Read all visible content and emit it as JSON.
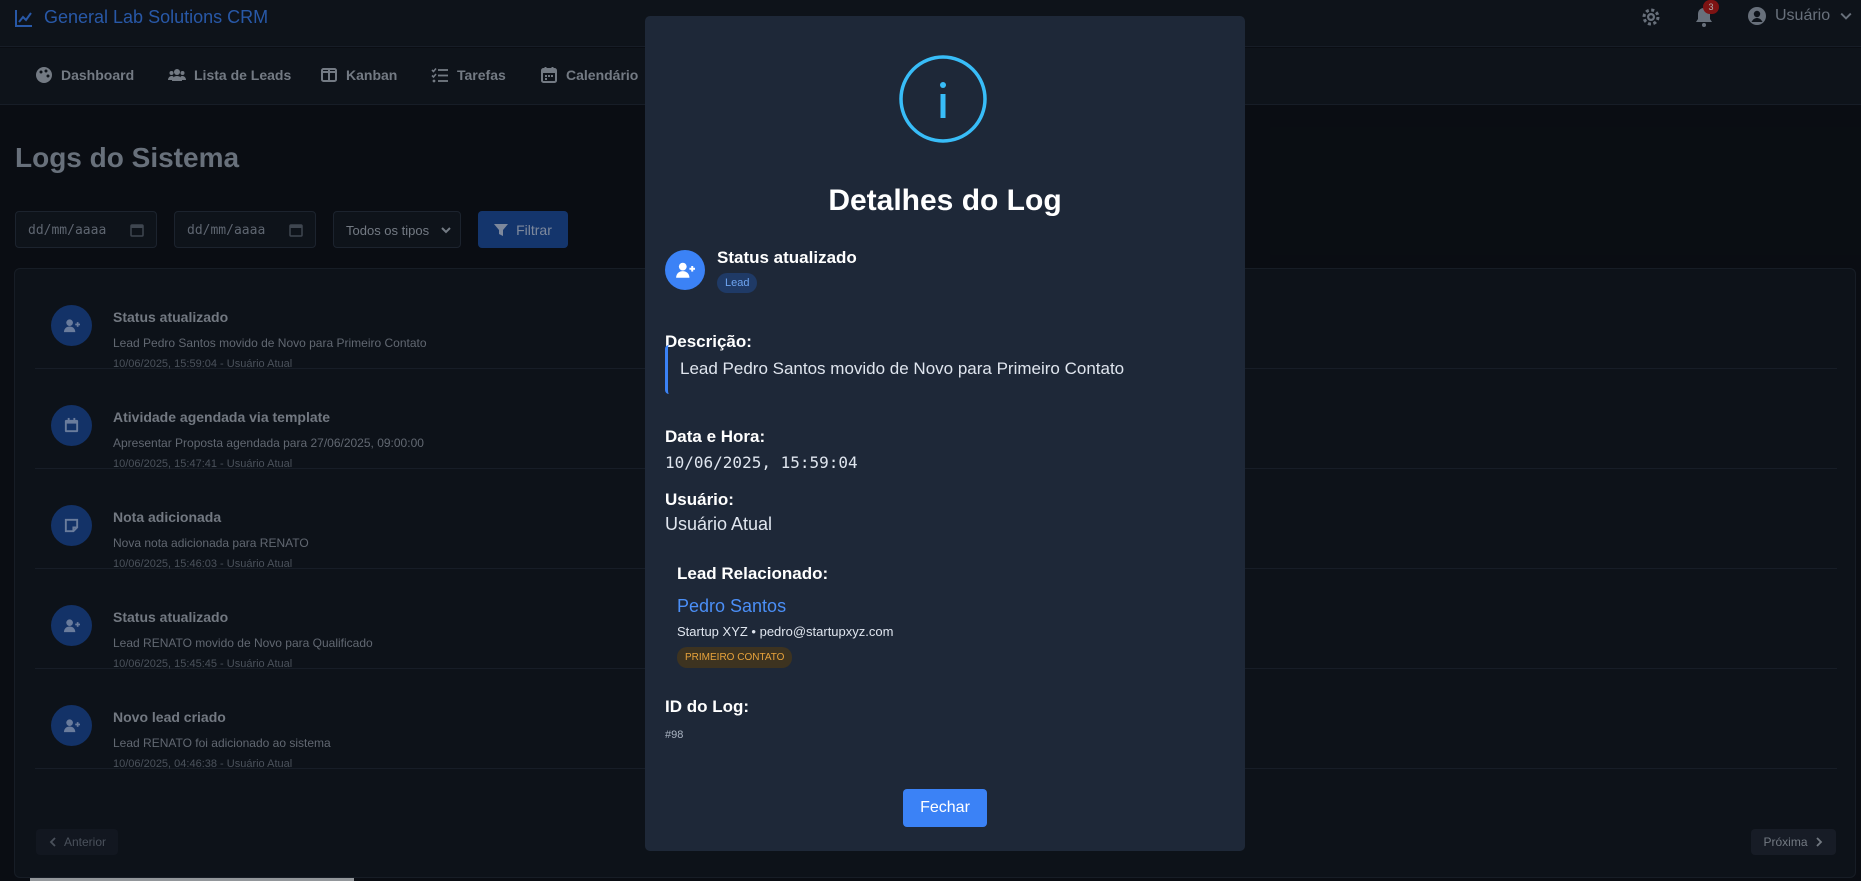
{
  "app": {
    "title": "General Lab Solutions CRM",
    "notification_count": "3",
    "user_label": "Usuário"
  },
  "nav": [
    {
      "label": "Dashboard",
      "icon": "palette-icon"
    },
    {
      "label": "Lista de Leads",
      "icon": "users-icon"
    },
    {
      "label": "Kanban",
      "icon": "columns-icon"
    },
    {
      "label": "Tarefas",
      "icon": "tasks-icon"
    },
    {
      "label": "Calendário",
      "icon": "calendar-icon"
    }
  ],
  "page": {
    "title": "Logs do Sistema"
  },
  "filters": {
    "date_from_placeholder": "dd/mm/aaaa",
    "date_to_placeholder": "dd/mm/aaaa",
    "type_selected": "Todos os tipos",
    "filter_button": "Filtrar"
  },
  "logs": [
    {
      "title": "Status atualizado",
      "description": "Lead Pedro Santos movido de Novo para Primeiro Contato",
      "meta": "10/06/2025, 15:59:04 - Usuário Atual",
      "icon": "user-plus-icon"
    },
    {
      "title": "Atividade agendada via template",
      "description": "Apresentar Proposta agendada para 27/06/2025, 09:00:00",
      "meta": "10/06/2025, 15:47:41 - Usuário Atual",
      "icon": "calendar-icon"
    },
    {
      "title": "Nota adicionada",
      "description": "Nova nota adicionada para RENATO",
      "meta": "10/06/2025, 15:46:03 - Usuário Atual",
      "icon": "note-icon"
    },
    {
      "title": "Status atualizado",
      "description": "Lead RENATO movido de Novo para Qualificado",
      "meta": "10/06/2025, 15:45:45 - Usuário Atual",
      "icon": "user-plus-icon"
    },
    {
      "title": "Novo lead criado",
      "description": "Lead RENATO foi adicionado ao sistema",
      "meta": "10/06/2025, 04:46:38 - Usuário Atual",
      "icon": "user-plus-icon"
    }
  ],
  "pagination": {
    "prev": "Anterior",
    "next": "Próxima"
  },
  "modal": {
    "title": "Detalhes do Log",
    "status": "Status atualizado",
    "badge": "Lead",
    "description_label": "Descrição:",
    "description": "Lead Pedro Santos movido de Novo para Primeiro Contato",
    "datetime_label": "Data e Hora:",
    "datetime": "10/06/2025, 15:59:04",
    "user_label": "Usuário:",
    "user": "Usuário Atual",
    "lead_label": "Lead Relacionado:",
    "lead_name": "Pedro Santos",
    "lead_info": "Startup XYZ • pedro@startupxyz.com",
    "lead_stage": "PRIMEIRO CONTATO",
    "id_label": "ID do Log:",
    "id": "#98",
    "close_button": "Fechar"
  },
  "colors": {
    "accent": "#3b82f6",
    "modal_bg": "#1e2838",
    "stage_badge": "#e8a33b",
    "info_icon": "#38bdf8"
  }
}
